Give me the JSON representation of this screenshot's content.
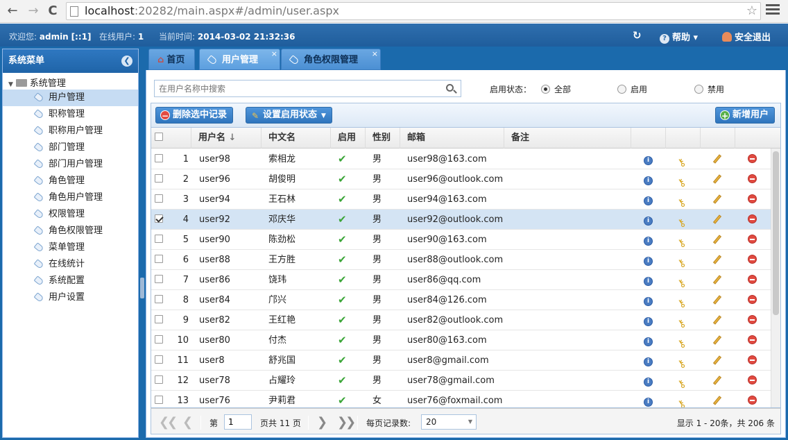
{
  "browser": {
    "url_host": "localhost",
    "url_rest": ":20282/main.aspx#/admin/user.aspx",
    "back": "←",
    "forward": "→",
    "reload": "C",
    "star": "☆"
  },
  "header": {
    "welcome_label": "欢迎您:",
    "user": "admin",
    "user_ip": "[::1]",
    "online_label": "在线用户:",
    "online_count": "1",
    "time_label": "当前时间:",
    "time_value": "2014-03-02 21:32:36",
    "help": "帮助",
    "logout": "安全退出"
  },
  "sidebar": {
    "title": "系统菜单",
    "root": "系统管理",
    "items": [
      "用户管理",
      "职称管理",
      "职称用户管理",
      "部门管理",
      "部门用户管理",
      "角色管理",
      "角色用户管理",
      "权限管理",
      "角色权限管理",
      "菜单管理",
      "在线统计",
      "系统配置",
      "用户设置"
    ],
    "selected_index": 0
  },
  "tabs": [
    {
      "label": "首页",
      "icon": "home-icon",
      "closable": false
    },
    {
      "label": "用户管理",
      "icon": "tag-icon",
      "closable": true,
      "active": true
    },
    {
      "label": "角色权限管理",
      "icon": "tag-icon",
      "closable": true
    }
  ],
  "tab_close": "×",
  "search": {
    "placeholder": "在用户名称中搜索",
    "status_label": "启用状态：",
    "options": [
      "全部",
      "启用",
      "禁用"
    ],
    "selected": "全部"
  },
  "toolbar": {
    "delete_label": "删除选中记录",
    "set_status_label": "设置启用状态",
    "add_label": "新增用户"
  },
  "grid": {
    "columns": [
      "用户名",
      "中文名",
      "启用",
      "性别",
      "邮箱",
      "备注"
    ],
    "sort_indicator": "↓",
    "rows": [
      {
        "n": "1",
        "user": "user98",
        "name": "索相龙",
        "gender": "男",
        "email": "user98@163.com"
      },
      {
        "n": "2",
        "user": "user96",
        "name": "胡俊明",
        "gender": "男",
        "email": "user96@outlook.com"
      },
      {
        "n": "3",
        "user": "user94",
        "name": "王石林",
        "gender": "男",
        "email": "user94@163.com"
      },
      {
        "n": "4",
        "user": "user92",
        "name": "邓庆华",
        "gender": "男",
        "email": "user92@outlook.com",
        "selected": true
      },
      {
        "n": "5",
        "user": "user90",
        "name": "陈劲松",
        "gender": "男",
        "email": "user90@163.com"
      },
      {
        "n": "6",
        "user": "user88",
        "name": "王方胜",
        "gender": "男",
        "email": "user88@outlook.com"
      },
      {
        "n": "7",
        "user": "user86",
        "name": "饶玮",
        "gender": "男",
        "email": "user86@qq.com"
      },
      {
        "n": "8",
        "user": "user84",
        "name": "邝兴",
        "gender": "男",
        "email": "user84@126.com"
      },
      {
        "n": "9",
        "user": "user82",
        "name": "王红艳",
        "gender": "男",
        "email": "user82@outlook.com"
      },
      {
        "n": "10",
        "user": "user80",
        "name": "付杰",
        "gender": "男",
        "email": "user80@163.com"
      },
      {
        "n": "11",
        "user": "user8",
        "name": "舒兆国",
        "gender": "男",
        "email": "user8@gmail.com"
      },
      {
        "n": "12",
        "user": "user78",
        "name": "占耀玲",
        "gender": "男",
        "email": "user78@gmail.com"
      },
      {
        "n": "13",
        "user": "user76",
        "name": "尹莉君",
        "gender": "女",
        "email": "user76@foxmail.com"
      }
    ]
  },
  "pager": {
    "page_prefix": "第",
    "page": "1",
    "page_suffix": "页共 11 页",
    "per_page_label": "每页记录数:",
    "per_page": "20",
    "info": "显示 1 - 20条，共 206 条"
  },
  "colors": {
    "header": "#1f5d9c",
    "selected_row": "#d4e4f4",
    "accent": "#2f75bd"
  }
}
